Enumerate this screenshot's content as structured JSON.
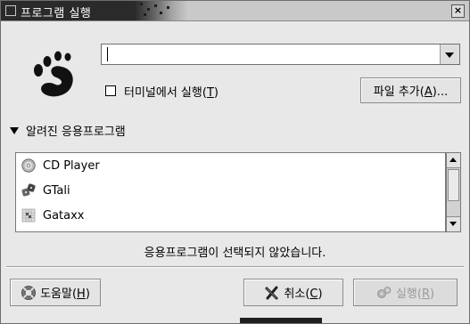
{
  "window": {
    "title": "프로그램 실행",
    "close_glyph": "×"
  },
  "command": {
    "value": ""
  },
  "terminal_check": {
    "label_prefix": "터미널에서 실행(",
    "mnemonic": "T",
    "label_suffix": ")",
    "checked": false
  },
  "add_file_button": {
    "label_prefix": "파일 추가(",
    "mnemonic": "A",
    "label_suffix": ")..."
  },
  "known_apps": {
    "section_label": "알려진 응용프로그램",
    "expanded": true,
    "items": [
      {
        "label": "CD Player",
        "icon": "cd-player-icon"
      },
      {
        "label": "GTali",
        "icon": "gtali-dice-icon"
      },
      {
        "label": "Gataxx",
        "icon": "gataxx-board-icon"
      }
    ]
  },
  "status_text": "응용프로그램이 선택되지 않았습니다.",
  "buttons": {
    "help": {
      "label_prefix": "도움말(",
      "mnemonic": "H",
      "label_suffix": ")",
      "icon": "help-lifebuoy-icon"
    },
    "cancel": {
      "label_prefix": "취소(",
      "mnemonic": "C",
      "label_suffix": ")",
      "icon": "cancel-x-icon"
    },
    "run": {
      "label_prefix": "실행(",
      "mnemonic": "R",
      "label_suffix": ")",
      "icon": "run-gears-icon",
      "enabled": false
    }
  },
  "colors": {
    "titlebar_active": "#2a2a2a",
    "dialog_bg": "#e8e8e8",
    "disabled_text": "#9a9a9a"
  }
}
